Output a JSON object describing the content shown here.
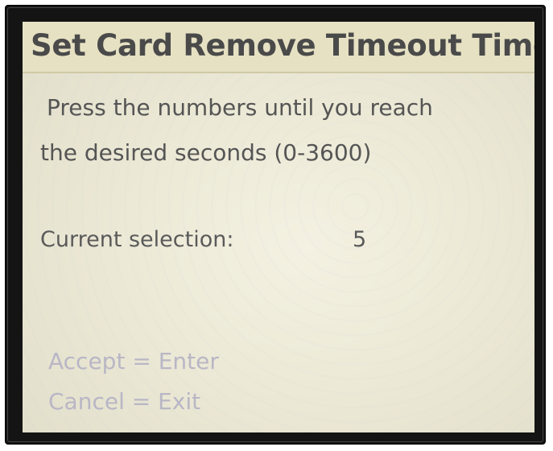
{
  "screen": {
    "title": "Set Card Remove Timeout Time",
    "instruction_line1": "Press the numbers until you reach",
    "instruction_line2": "the desired seconds (0-3600)",
    "selection_label": "Current selection:",
    "selection_value": "5",
    "accept_hint": "Accept = Enter",
    "cancel_hint": "Cancel = Exit"
  },
  "colors": {
    "screen_background": "#ece9d6",
    "title_bar": "#e6e1c3",
    "text": "#555555",
    "hint_text": "#b9b6c6",
    "bezel": "#141414"
  }
}
